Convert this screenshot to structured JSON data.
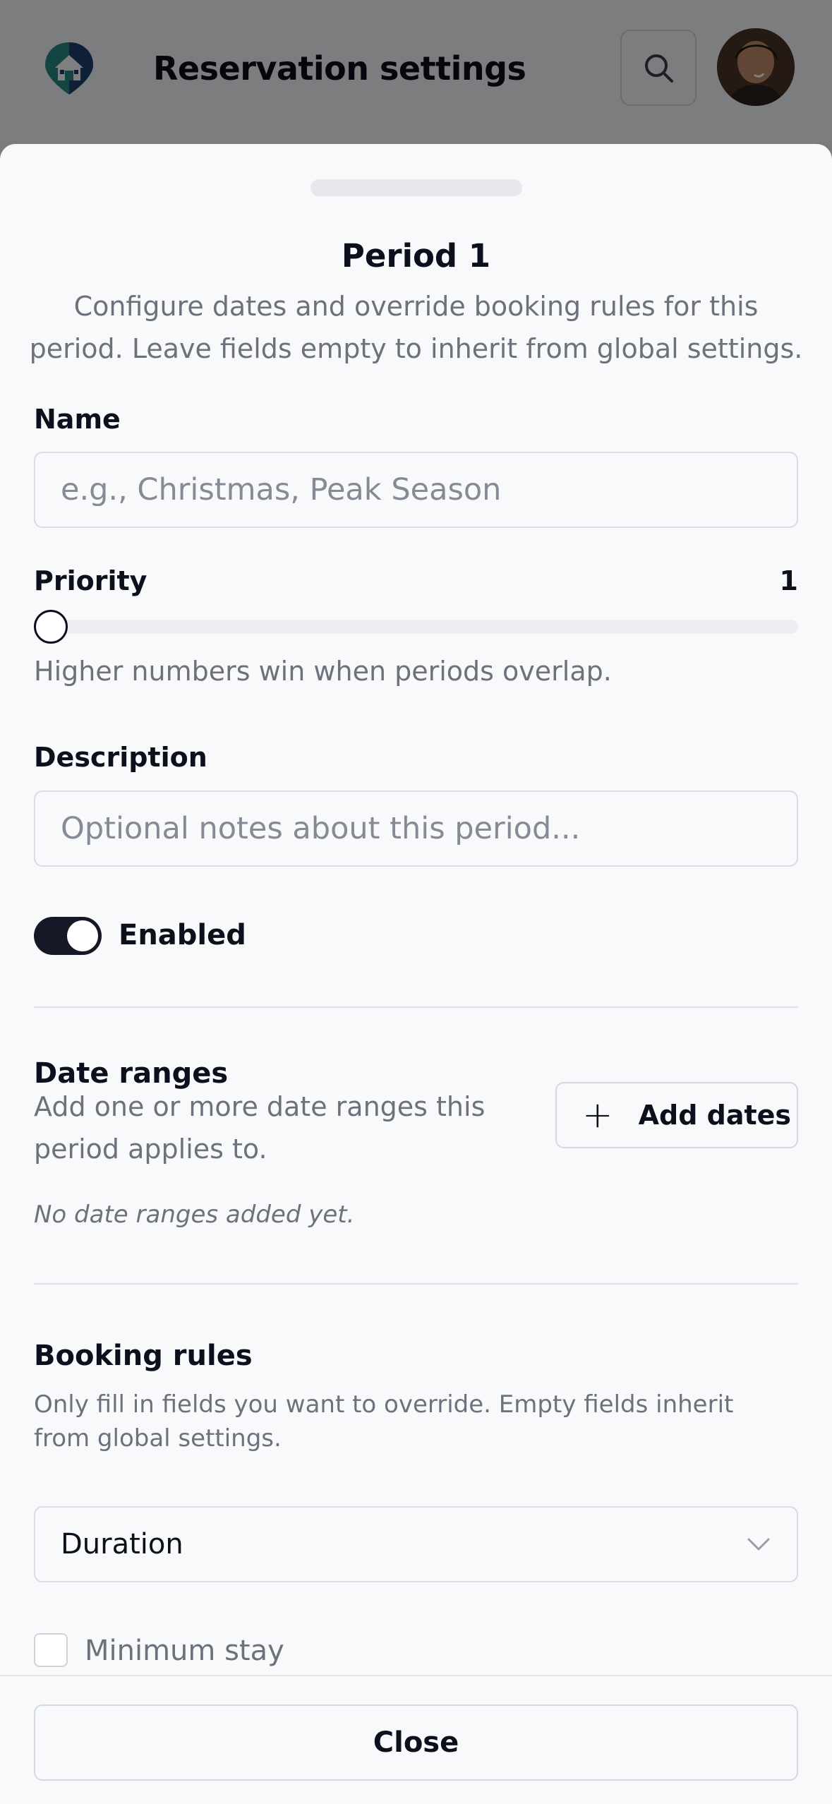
{
  "header": {
    "title": "Reservation settings"
  },
  "sheet": {
    "title": "Period 1",
    "description": "Configure dates and override booking rules for this period. Leave fields empty to inherit from global settings.",
    "name": {
      "label": "Name",
      "value": "",
      "placeholder": "e.g., Christmas, Peak Season"
    },
    "priority": {
      "label": "Priority",
      "value": "1",
      "help": "Higher numbers win when periods overlap.",
      "slider_fraction": 0.0
    },
    "description_field": {
      "label": "Description",
      "value": "",
      "placeholder": "Optional notes about this period..."
    },
    "enabled": {
      "label": "Enabled",
      "on": true
    },
    "date_ranges": {
      "title": "Date ranges",
      "description": "Add one or more date ranges this period applies to.",
      "add_label": "Add dates",
      "empty_note": "No date ranges added yet."
    },
    "booking_rules": {
      "title": "Booking rules",
      "description": "Only fill in fields you want to override. Empty fields inherit from global settings.",
      "select_value": "Duration",
      "checkbox_label": "Minimum stay",
      "checkbox_checked": false
    },
    "close_label": "Close"
  },
  "icons": {
    "logo": "house-logo-icon",
    "search": "search-icon",
    "chevron": "chevron-down-icon",
    "plus": "plus-icon"
  },
  "colors": {
    "primary": "#0d0f1c",
    "muted_text": "#6e717c",
    "border": "#d8dbe1",
    "logo_teal": "#2a8a86",
    "logo_navy": "#1f3f6e"
  }
}
